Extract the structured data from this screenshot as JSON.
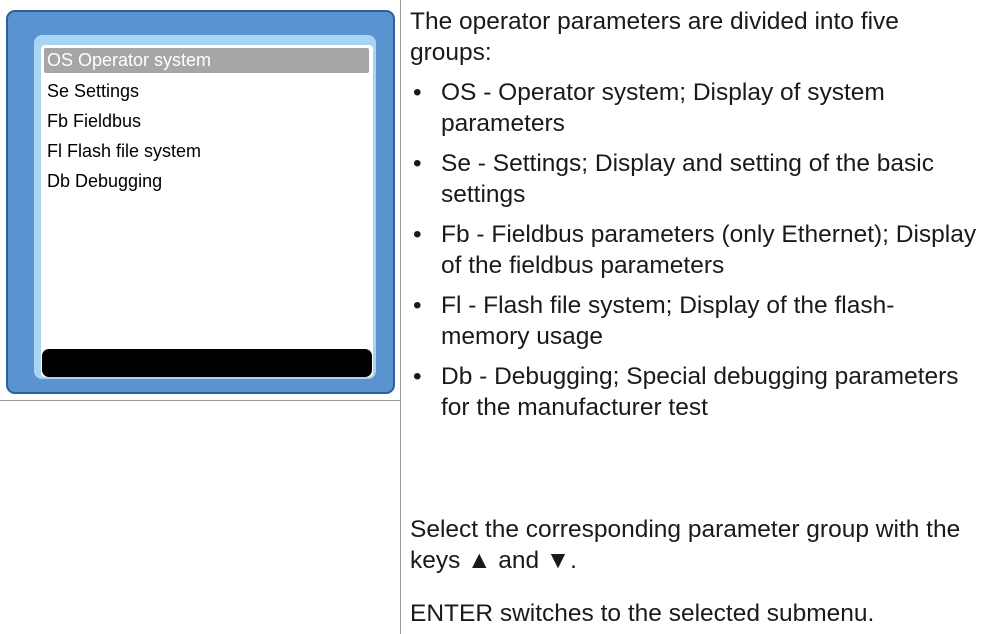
{
  "device_display": {
    "menu_items": [
      {
        "label": "OS Operator system",
        "selected": true
      },
      {
        "label": "Se Settings",
        "selected": false
      },
      {
        "label": "Fb Fieldbus",
        "selected": false
      },
      {
        "label": "Fl Flash file system",
        "selected": false
      },
      {
        "label": "Db Debugging",
        "selected": false
      }
    ]
  },
  "description": {
    "intro": "The operator parameters are divided into five groups:",
    "bullet_symbol": "•",
    "bullets": [
      "OS - Operator system; Display of system parameters",
      "Se - Settings; Display and setting of the basic settings",
      "Fb - Fieldbus parameters (only Ethernet); Display of the fieldbus parameters",
      "Fl - Flash file system; Display of the flash-memory usage",
      "Db - Debugging; Special debugging parameters for the manufacturer test"
    ],
    "select_text": "Select the corresponding parameter group with the keys ▲ and ▼.",
    "enter_text": "ENTER switches to the selected submenu."
  },
  "colors": {
    "device_body": "#5a93cf",
    "device_border": "#2c5f9c",
    "screen_bezel": "#a9d5f4",
    "selection_highlight": "#a6a6a6",
    "status_bar": "#000000"
  }
}
